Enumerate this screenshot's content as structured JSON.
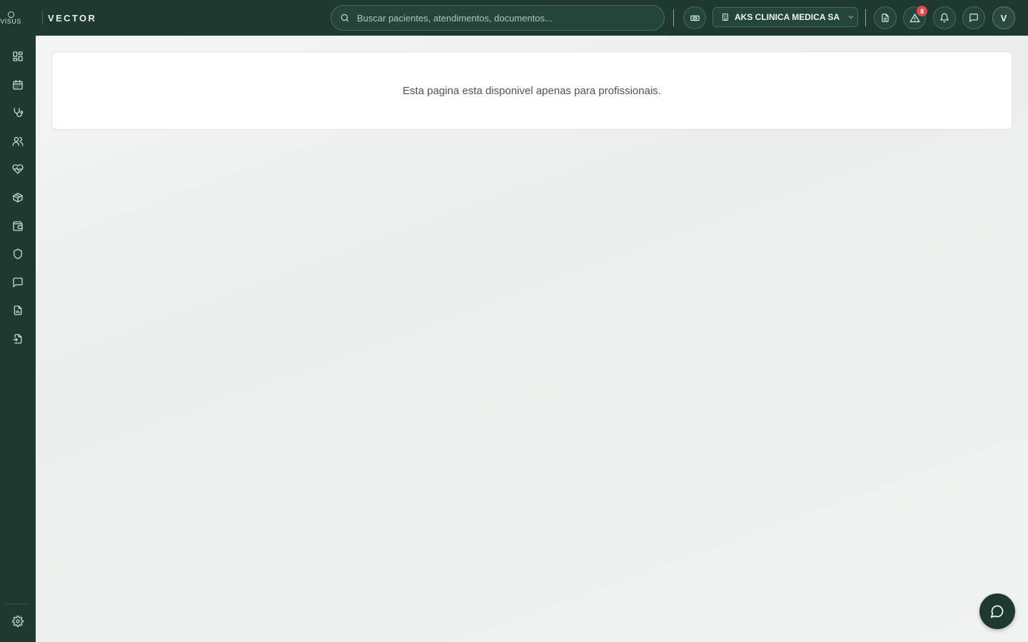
{
  "brand": {
    "logo_text": "VISUS",
    "app_name": "VECTOR"
  },
  "search": {
    "placeholder": "Buscar pacientes, atendimentos, documentos..."
  },
  "header": {
    "clinic_name": "AKS CLINICA MEDICA SA",
    "alerts_count": "8",
    "avatar_initial": "V"
  },
  "sidebar": {
    "items": [
      {
        "icon": "dashboard-icon"
      },
      {
        "icon": "calendar-icon"
      },
      {
        "icon": "stethoscope-icon"
      },
      {
        "icon": "users-icon"
      },
      {
        "icon": "heart-pulse-icon"
      },
      {
        "icon": "package-icon"
      },
      {
        "icon": "wallet-icon"
      },
      {
        "icon": "shield-icon"
      },
      {
        "icon": "message-icon"
      },
      {
        "icon": "report-icon"
      },
      {
        "icon": "document-exchange-icon"
      }
    ],
    "settings_icon": "gear-icon"
  },
  "main": {
    "message": "Esta pagina esta disponivel apenas para profissionais."
  },
  "colors": {
    "primary": "#1e3a30",
    "badge": "#e5484d",
    "background": "#f1f3f2"
  }
}
